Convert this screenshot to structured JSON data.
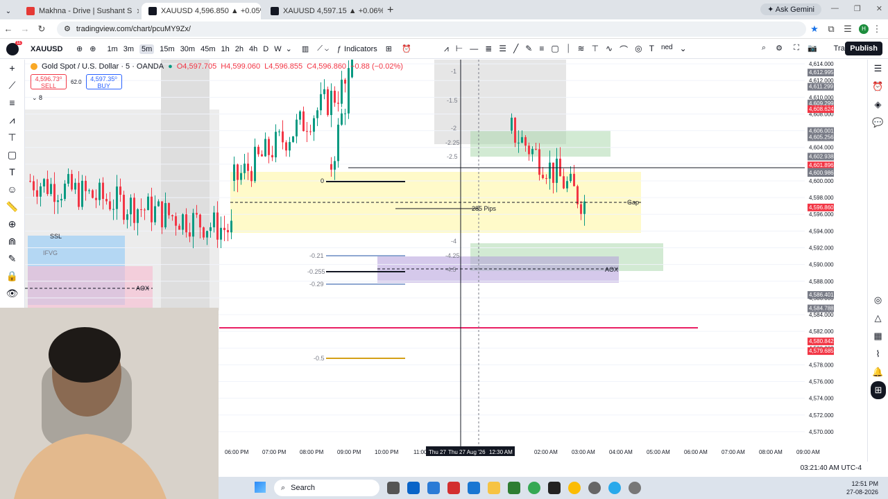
{
  "browser": {
    "tabs": [
      {
        "title": "Makhna - Drive | Sushant S",
        "favicon": "youtube-icon",
        "color": "#e53935",
        "active": false
      },
      {
        "title": "XAUUSD 4,596.850 ▲ +0.05% U",
        "favicon": "tradingview-icon",
        "color": "#131722",
        "active": true
      },
      {
        "title": "XAUUSD 4,597.15 ▲ +0.06% U",
        "favicon": "tradingview-icon",
        "color": "#131722",
        "active": false
      }
    ],
    "ask_gemini": "Ask Gemini",
    "url": "tradingview.com/chart/pcuMY9Zx/",
    "profile_initial": "H"
  },
  "toolbar": {
    "symbol": "XAUUSD",
    "avatar_badge": "11",
    "timeframes": [
      "1m",
      "3m",
      "5m",
      "15m",
      "30m",
      "45m",
      "1h",
      "2h",
      "4h",
      "D",
      "W"
    ],
    "selected_timeframe": "5m",
    "indicators": "Indicators",
    "trade": "Trade",
    "publish": "Publish",
    "truncated_text": "ned"
  },
  "legend": {
    "title": "Gold Spot / U.S. Dollar · 5 · OANDA",
    "o": "O4,597.705",
    "h": "H4,599.060",
    "l": "L4,596.855",
    "c": "C4,596.860",
    "chg": "−0.88 (−0.02%)",
    "sell_price": "4,596.73⁰",
    "sell_label": "SELL",
    "spread": "62.0",
    "buy_price": "4,597.35⁰",
    "buy_label": "BUY",
    "collapse_count": "8"
  },
  "chart_data": {
    "type": "candlestick",
    "symbol": "XAUUSD",
    "interval": "5",
    "ylim": [
      4569,
      4615
    ],
    "price_ticks": [
      4614,
      4612,
      4610,
      4608,
      4606,
      4604,
      4602,
      4600,
      4598,
      4596,
      4594,
      4592,
      4590,
      4588,
      4586,
      4584,
      4582,
      4580,
      4578,
      4576,
      4574,
      4572,
      4570
    ],
    "price_tick_labels": [
      "4,614.000",
      "4,612.000",
      "4,610.000",
      "4,608.000",
      "4,606.000",
      "4,604.000",
      "4,602.000",
      "4,600.000",
      "4,598.000",
      "4,596.000",
      "4,594.000",
      "4,592.000",
      "4,590.000",
      "4,588.000",
      "4,586.000",
      "4,584.000",
      "4,582.000",
      "4,580.000",
      "4,578.000",
      "4,576.000",
      "4,574.000",
      "4,572.000",
      "4,570.000"
    ],
    "time_labels": [
      "06:00 PM",
      "07:00 PM",
      "08:00 PM",
      "09:00 PM",
      "10:00 PM",
      "11:00",
      "12:30 AM",
      "02:00 AM",
      "03:00 AM",
      "04:00 AM",
      "05:00 AM",
      "06:00 AM",
      "07:00 AM",
      "08:00 AM",
      "09:00 AM"
    ],
    "crosshair_time_left": "Thu 27",
    "crosshair_time": "Thu 27 Aug '26",
    "price_labels": [
      {
        "text": "4,612.995",
        "bg": "#787b86",
        "value": 4612.995
      },
      {
        "text": "4,611.299",
        "bg": "#787b86",
        "value": 4611.299
      },
      {
        "text": "4,609.299",
        "bg": "#787b86",
        "value": 4609.299
      },
      {
        "text": "4,608.624",
        "bg": "#f23645",
        "value": 4608.624
      },
      {
        "text": "4,606.001",
        "bg": "#787b86",
        "value": 4606.001
      },
      {
        "text": "4,605.256",
        "bg": "#787b86",
        "value": 4605.256
      },
      {
        "text": "4,602.938",
        "bg": "#787b86",
        "value": 4602.938
      },
      {
        "text": "4,601.896",
        "bg": "#f23645",
        "value": 4601.896
      },
      {
        "text": "4,601.123",
        "bg": "#787b86",
        "value": 4601.123
      },
      {
        "text": "4,600.986",
        "bg": "#787b86",
        "value": 4600.986
      },
      {
        "text": "4,596.860",
        "bg": "#f23645",
        "value": 4596.86
      },
      {
        "text": "4,586.401",
        "bg": "#787b86",
        "value": 4586.401
      },
      {
        "text": "4,584.788",
        "bg": "#787b86",
        "value": 4584.788
      },
      {
        "text": "4,580.842",
        "bg": "#f23645",
        "value": 4580.842
      },
      {
        "text": "4,579.685",
        "bg": "#f23645",
        "value": 4579.685
      }
    ],
    "countdown": "03:20",
    "annotations": [
      "0",
      "285 Pips",
      "Gap",
      "AOX",
      "AOX",
      "SSL",
      "IFVG",
      "-0.21",
      "-0.255",
      "-0.29",
      "-0.5",
      "-1",
      "-1.5",
      "-2",
      "-2.25",
      "-2.5",
      "-4",
      "-4.25",
      "-4.5"
    ],
    "colors": {
      "up": "#089981",
      "down": "#f23645",
      "fvg_yellow": "#fff59d",
      "zone_green": "#a5d6a7",
      "zone_purple": "#b39ddb",
      "zone_pink": "#f8bbd0",
      "zone_blue": "#90caf9",
      "redline": "#e91e63"
    },
    "timezone_clock": "03:21:40 AM UTC-4"
  },
  "taskbar": {
    "search": "Search",
    "time": "12:51 PM",
    "date": "27-08-2026"
  }
}
